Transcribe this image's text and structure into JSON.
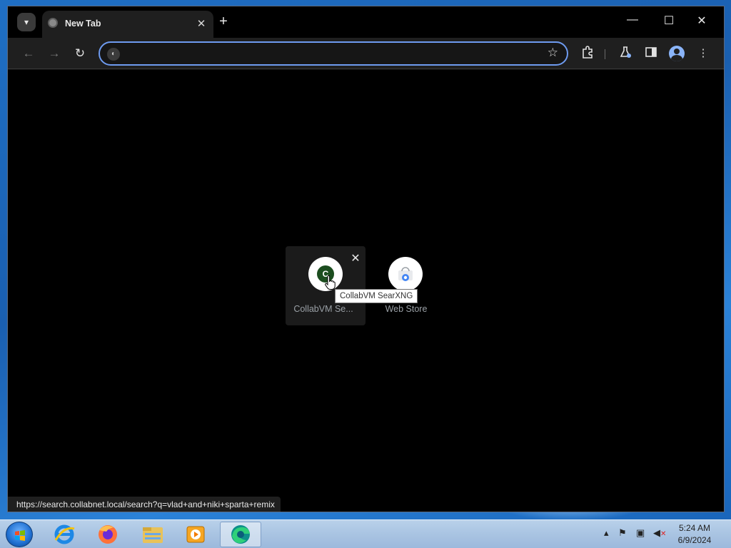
{
  "browser": {
    "tab_title": "New Tab",
    "tab_close": "✕",
    "new_tab": "+",
    "omnibox_value": "",
    "window_controls": {
      "minimize": "—",
      "maximize": "☐",
      "close": "✕"
    }
  },
  "shortcuts": [
    {
      "letter": "C",
      "label": "CollabVM Se...",
      "tooltip": "CollabVM SearXNG",
      "remove": "✕"
    },
    {
      "label": "Web Store"
    }
  ],
  "status_url": "https://search.collabnet.local/search?q=vlad+and+niki+sparta+remix",
  "taskbar": {
    "time": "5:24 AM",
    "date": "6/9/2024"
  },
  "colors": {
    "omnibox_border": "#6e9bf0",
    "searxng_icon": "#1c4d1f",
    "content_bg": "#000000"
  },
  "icons": [
    "tab-search-icon",
    "globe-favicon",
    "back-arrow-icon",
    "forward-arrow-icon",
    "reload-icon",
    "site-info-icon",
    "bookmark-star-icon",
    "extensions-icon",
    "labs-flask-icon",
    "side-panel-icon",
    "profile-avatar-icon",
    "menu-dots-icon",
    "start-orb",
    "ie-icon",
    "firefox-icon",
    "explorer-folder-icon",
    "media-player-icon",
    "edge-icon",
    "tray-chevron-icon",
    "flag-icon",
    "network-icon",
    "volume-mute-icon"
  ]
}
